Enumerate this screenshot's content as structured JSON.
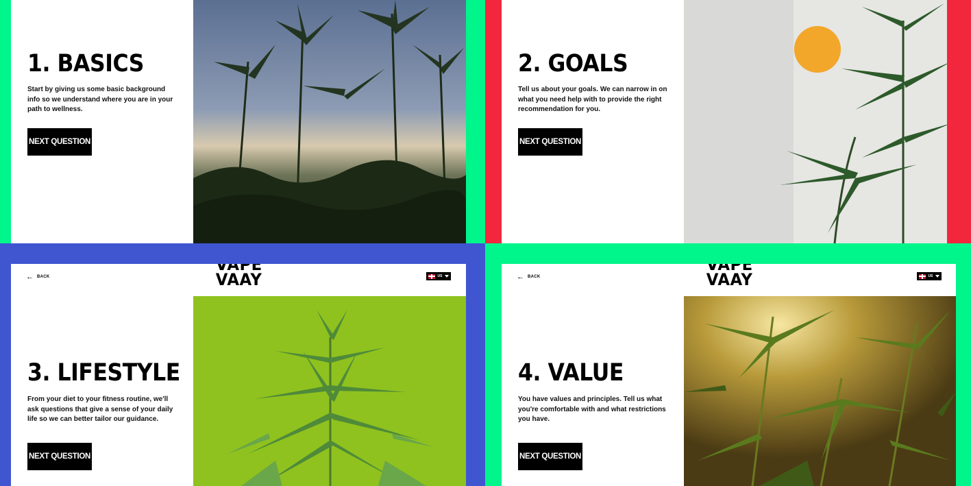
{
  "colors": {
    "q1_frame": "#00f58b",
    "q2_frame": "#f2263d",
    "q3_frame": "#3f56d0",
    "q4_frame": "#00f58b",
    "button": "#000000"
  },
  "brand": {
    "logo_line1": "VAPE",
    "logo_line2": "VAAY"
  },
  "header": {
    "back_label": "BACK",
    "back_icon": "arrow-left-icon",
    "language_code": "US",
    "flag_icon": "uk-flag-icon",
    "dropdown_icon": "caret-down-icon"
  },
  "screens": [
    {
      "title": "1. BASICS",
      "description": "Start by giving us some basic background info so we understand where you are in your path to wellness.",
      "button": "NEXT QUESTION"
    },
    {
      "title": "2. GOALS",
      "description": "Tell us about your goals. We can narrow in on what you need help with to provide the right recommendation for you.",
      "button": "NEXT QUESTION"
    },
    {
      "title": "3. LIFESTYLE",
      "description": "From your diet to your fitness routine, we'll ask questions that give a sense of your daily life so we can better tailor our guidance.",
      "button": "NEXT QUESTION"
    },
    {
      "title": "4. VALUE",
      "description": "You have values and principles. Tell us what you're comfortable with and what restrictions you have.",
      "button": "NEXT QUESTION"
    }
  ]
}
